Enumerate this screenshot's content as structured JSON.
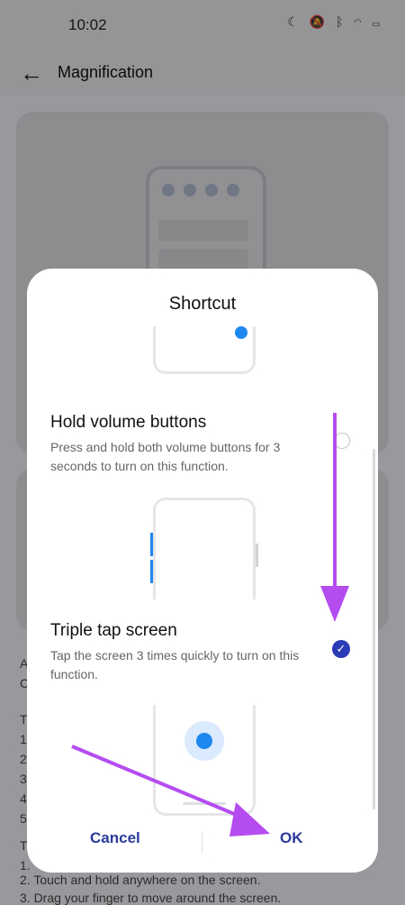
{
  "status_bar": {
    "time": "10:02",
    "icons": [
      "moon-icon",
      "bell-off-icon",
      "bluetooth-icon",
      "wifi-icon",
      "battery-icon"
    ]
  },
  "app_bar": {
    "title": "Magnification"
  },
  "background_content": {
    "lines": [
      "A",
      "C",
      "T",
      "1",
      "2",
      "3",
      "4",
      "5",
      "T"
    ],
    "instructions": [
      "1.",
      "2. Touch and hold anywhere on the screen.",
      "3. Drag your finger to move around the screen."
    ]
  },
  "dialog": {
    "title": "Shortcut",
    "options": [
      {
        "title": "Hold volume buttons",
        "description": "Press and hold both volume buttons for 3 seconds to turn on this function.",
        "selected": false
      },
      {
        "title": "Triple tap screen",
        "description": "Tap the screen 3 times quickly to turn on this function.",
        "selected": true
      }
    ],
    "cancel_label": "Cancel",
    "ok_label": "OK"
  },
  "colors": {
    "accent": "#2a3bb5",
    "annotation_arrow": "#b44cf0",
    "tap_dot": "#1e88f0"
  }
}
